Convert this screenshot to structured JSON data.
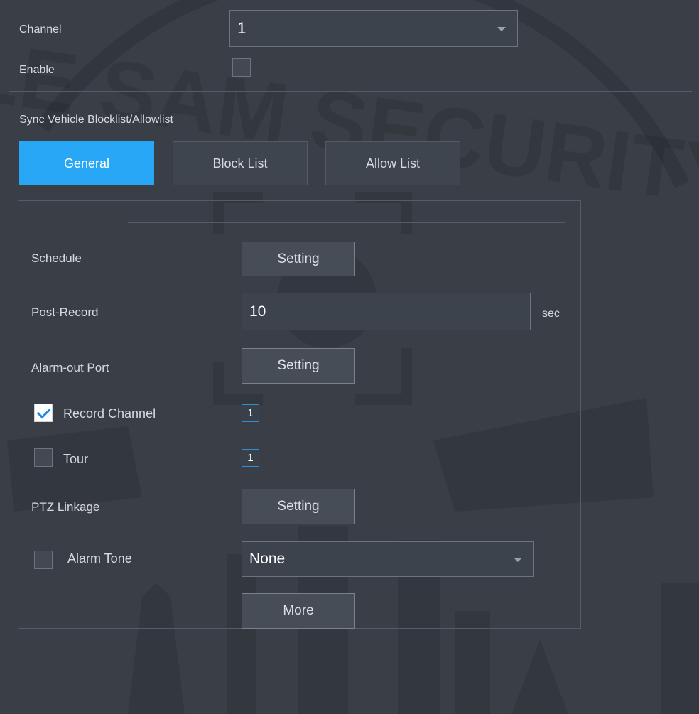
{
  "header": {
    "channel_label": "Channel",
    "channel_value": "1",
    "enable_label": "Enable",
    "enable_checked": false,
    "sync_label": "Sync Vehicle Blocklist/Allowlist"
  },
  "tabs": [
    {
      "label": "General",
      "active": true
    },
    {
      "label": "Block List",
      "active": false
    },
    {
      "label": "Allow List",
      "active": false
    }
  ],
  "general": {
    "schedule_label": "Schedule",
    "schedule_button": "Setting",
    "post_record_label": "Post-Record",
    "post_record_value": "10",
    "post_record_unit": "sec",
    "alarm_out_label": "Alarm-out Port",
    "alarm_out_button": "Setting",
    "record_channel_label": "Record Channel",
    "record_channel_checked": true,
    "record_channel_value": "1",
    "tour_label": "Tour",
    "tour_checked": false,
    "tour_value": "1",
    "ptz_label": "PTZ Linkage",
    "ptz_button": "Setting",
    "alarm_tone_label": "Alarm Tone",
    "alarm_tone_checked": false,
    "alarm_tone_value": "None",
    "more_button": "More"
  },
  "watermark_text": "LE SAM SECURITY",
  "colors": {
    "background": "#3a3f47",
    "accent": "#27a7f5",
    "checkbox_check": "#1e88e5"
  }
}
